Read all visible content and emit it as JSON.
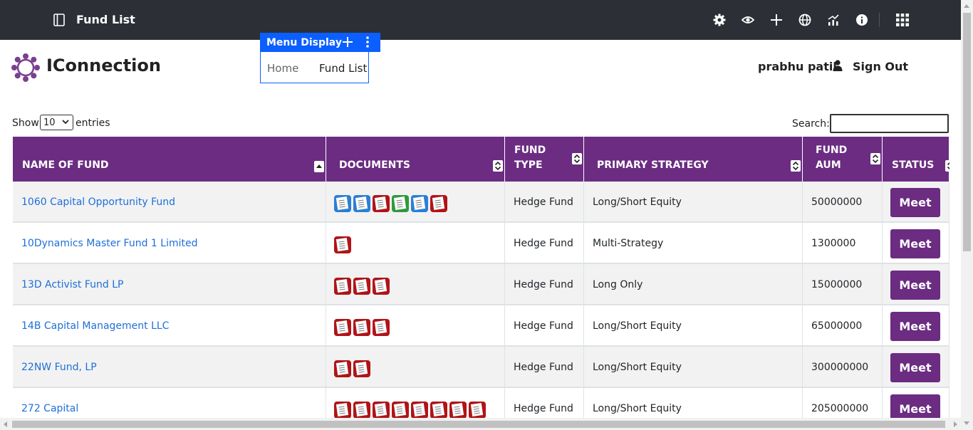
{
  "topbar": {
    "title": "Fund List",
    "icons": [
      "panel-toggle-icon",
      "gear-icon",
      "eye-icon",
      "plus-icon",
      "globe-icon",
      "analytics-icon",
      "info-icon",
      "apps-grid-icon"
    ]
  },
  "brand": {
    "name": "IConnection"
  },
  "menu_display": {
    "label": "Menu Display",
    "items": [
      "Home",
      "Fund List"
    ]
  },
  "user": {
    "name": "prabhu patil",
    "sign_out": "Sign Out"
  },
  "table_controls": {
    "show_label": "Show",
    "entries_value": "10",
    "entries_label": "entries",
    "search_label": "Search:",
    "search_value": ""
  },
  "table": {
    "columns": [
      {
        "label": "NAME OF FUND",
        "sort": "asc"
      },
      {
        "label": "DOCUMENTS",
        "sort": "both"
      },
      {
        "label": "FUND TYPE",
        "sort": "both"
      },
      {
        "label": "PRIMARY STRATEGY",
        "sort": "both"
      },
      {
        "label": "FUND AUM",
        "sort": "both"
      },
      {
        "label": "STATUS",
        "sort": "both"
      }
    ],
    "rows": [
      {
        "name": "1060 Capital Opportunity Fund",
        "docs": [
          "word",
          "word",
          "pdf",
          "xls",
          "word",
          "pdf"
        ],
        "type": "Hedge Fund",
        "strategy": "Long/Short Equity",
        "aum": "50000000",
        "status": "Meet"
      },
      {
        "name": "10Dynamics Master Fund 1 Limited",
        "docs": [
          "pdf"
        ],
        "type": "Hedge Fund",
        "strategy": "Multi-Strategy",
        "aum": "1300000",
        "status": "Meet"
      },
      {
        "name": "13D Activist Fund LP",
        "docs": [
          "pdf",
          "pdf",
          "pdf"
        ],
        "type": "Hedge Fund",
        "strategy": "Long Only",
        "aum": "15000000",
        "status": "Meet"
      },
      {
        "name": "14B Capital Management LLC",
        "docs": [
          "pdf",
          "pdf",
          "pdf"
        ],
        "type": "Hedge Fund",
        "strategy": "Long/Short Equity",
        "aum": "65000000",
        "status": "Meet"
      },
      {
        "name": "22NW Fund, LP",
        "docs": [
          "pdf",
          "pdf"
        ],
        "type": "Hedge Fund",
        "strategy": "Long/Short Equity",
        "aum": "300000000",
        "status": "Meet"
      },
      {
        "name": "272 Capital",
        "docs": [
          "pdf",
          "pdf",
          "pdf",
          "pdf",
          "pdf",
          "pdf",
          "pdf",
          "pdf"
        ],
        "type": "Hedge Fund",
        "strategy": "Long/Short Equity",
        "aum": "205000000",
        "status": "Meet"
      }
    ]
  },
  "colors": {
    "topbar": "#2c2f36",
    "accent": "#6b2c82",
    "menu_blue": "#0b5fff",
    "link": "#1e6fd9",
    "pdf": "#b01418",
    "word": "#2a7fd6",
    "xls": "#2e9a3b"
  }
}
